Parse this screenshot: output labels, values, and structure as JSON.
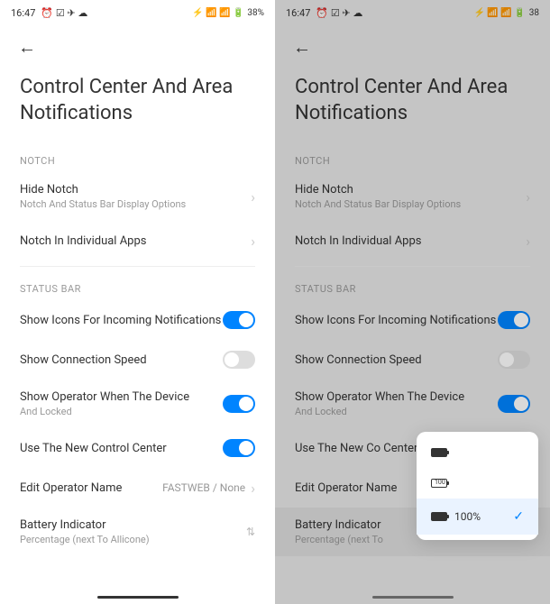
{
  "status": {
    "time": "16:47",
    "icons_left": "⏰ ☑ ✈ ☁",
    "icons_right": "⚡ 📶 📶 🔋",
    "battery": "38%",
    "battery_right": "38"
  },
  "nav": {
    "back": "←"
  },
  "title": "Control Center And Area Notifications",
  "sections": {
    "notch": {
      "header": "NOTCH",
      "hide_notch": {
        "label": "Hide Notch",
        "sub": "Notch And Status Bar Display Options"
      },
      "individual_apps": {
        "label": "Notch In Individual Apps"
      }
    },
    "statusbar": {
      "header": "STATUS BAR",
      "incoming": {
        "label": "Show Icons For Incoming Notifications"
      },
      "connection": {
        "label": "Show Connection Speed"
      },
      "operator": {
        "label": "Show Operator When The Device",
        "sub": "And Locked"
      },
      "control_center": {
        "label": "Use The New Control Center"
      },
      "control_center_short": {
        "label": "Use The New Co Center"
      },
      "edit_operator": {
        "label": "Edit Operator Name",
        "value": "FASTWEB / None"
      },
      "battery_indicator": {
        "label": "Battery Indicator",
        "sub": "Percentage (next To Allicone)"
      },
      "battery_indicator_right": {
        "label": "Battery Indicator",
        "sub": "Percentage (next To"
      }
    }
  },
  "popup": {
    "option3_text": "100%"
  }
}
